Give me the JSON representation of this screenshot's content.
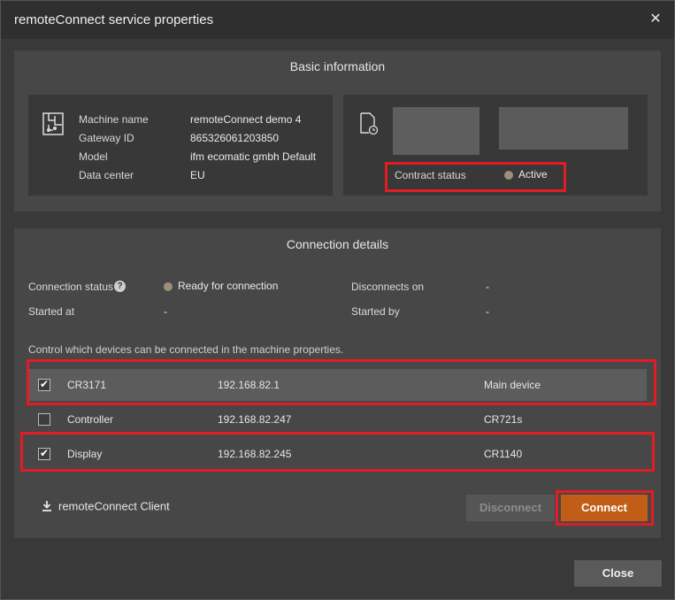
{
  "window": {
    "title": "remoteConnect service properties",
    "close_glyph": "✕"
  },
  "basic": {
    "title": "Basic information",
    "icon": "machine-schematic-icon",
    "fields": [
      {
        "label": "Machine name",
        "value": "remoteConnect demo 4"
      },
      {
        "label": "Gateway ID",
        "value": "865326061203850"
      },
      {
        "label": "Model",
        "value": "ifm ecomatic gmbh Default"
      },
      {
        "label": "Data center",
        "value": "EU"
      }
    ],
    "contract": {
      "icon": "document-clock-icon",
      "label": "Contract status",
      "value": "Active",
      "dot_color": "#9b8f7a"
    }
  },
  "connection": {
    "title": "Connection details",
    "status_label": "Connection status",
    "status_value": "Ready for connection",
    "help_glyph": "?",
    "disconnects_label": "Disconnects on",
    "disconnects_value": "-",
    "started_at_label": "Started at",
    "started_at_value": "-",
    "started_by_label": "Started by",
    "started_by_value": "-",
    "hint": "Control which devices can be connected in the machine properties.",
    "devices": [
      {
        "name": "CR3171",
        "ip": "192.168.82.1",
        "type": "Main device",
        "checked": true
      },
      {
        "name": "Controller",
        "ip": "192.168.82.247",
        "type": "CR721s",
        "checked": false
      },
      {
        "name": "Display",
        "ip": "192.168.82.245",
        "type": "CR1140",
        "checked": true
      }
    ],
    "client_link": "remoteConnect Client",
    "disconnect_label": "Disconnect",
    "connect_label": "Connect"
  },
  "footer": {
    "close_label": "Close"
  },
  "colors": {
    "accent": "#c15d16",
    "highlight": "#e31b23"
  }
}
